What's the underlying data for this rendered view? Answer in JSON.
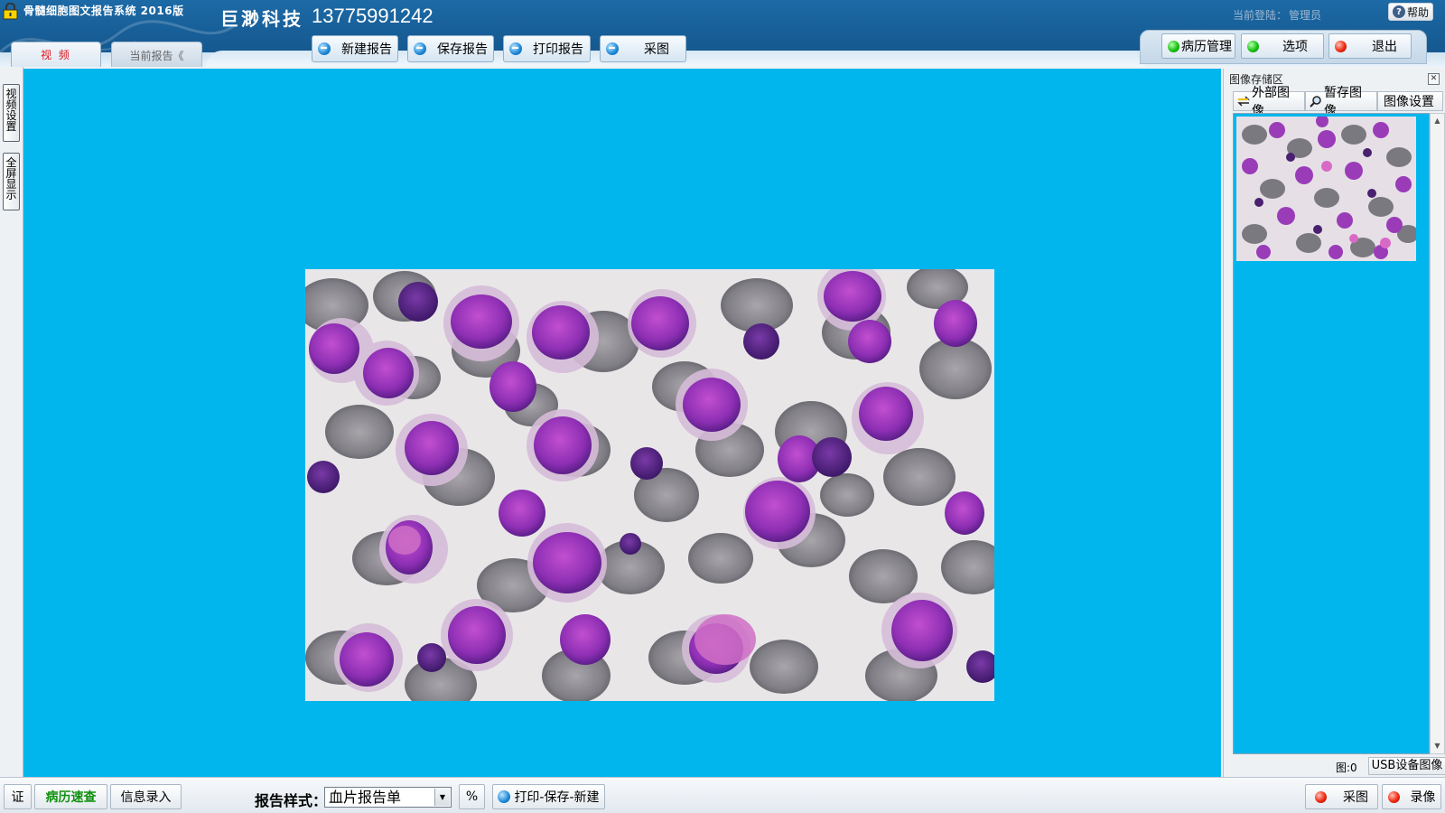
{
  "app": {
    "title": "骨髓细胞图文报告系统 2016版",
    "company": "巨渺科技",
    "phone": "13775991242",
    "login_prefix": "当前登陆：",
    "login_user": "管理员",
    "help_label": "帮助"
  },
  "tabs": {
    "video": "视 频",
    "current_report": "当前报告《"
  },
  "toolbar": {
    "new_report": "新建报告",
    "save_report": "保存报告",
    "print_report": "打印报告",
    "capture": "采图"
  },
  "right_toolbar": {
    "records": "病历管理",
    "options": "选项",
    "exit": "退出"
  },
  "left_tabs": {
    "video_settings": [
      "视",
      "频",
      "设",
      "置"
    ],
    "fullscreen": [
      "全",
      "屏",
      "显",
      "示"
    ]
  },
  "image_panel": {
    "title": "图像存储区",
    "tabs": {
      "external": "外部图像",
      "temp": "暂存图像",
      "settings": "图像设置"
    },
    "count_label": "图:0",
    "usb_button": "USB设备图像"
  },
  "bottom": {
    "cert": "证",
    "quick_records": "病历速查",
    "info_entry": "信息录入",
    "style_label": "报告样式：",
    "style_value": "血片报告单",
    "percent": "%",
    "print_save_new": "打印-保存-新建",
    "capture": "采图",
    "record": "录像"
  },
  "colors": {
    "header_blue": "#175d96",
    "video_bg": "#00b6ed",
    "tab_active_text": "#e0161b",
    "green_led": "#17c40f",
    "red_led": "#ee2a12",
    "quick_records_text": "#10900f"
  },
  "icons": {
    "app_lock": "lock-icon",
    "help": "question-icon",
    "toolbar_buttons": "blue-arrow-circle-icon",
    "green_status": "green-led-icon",
    "red_status": "red-led-icon"
  }
}
